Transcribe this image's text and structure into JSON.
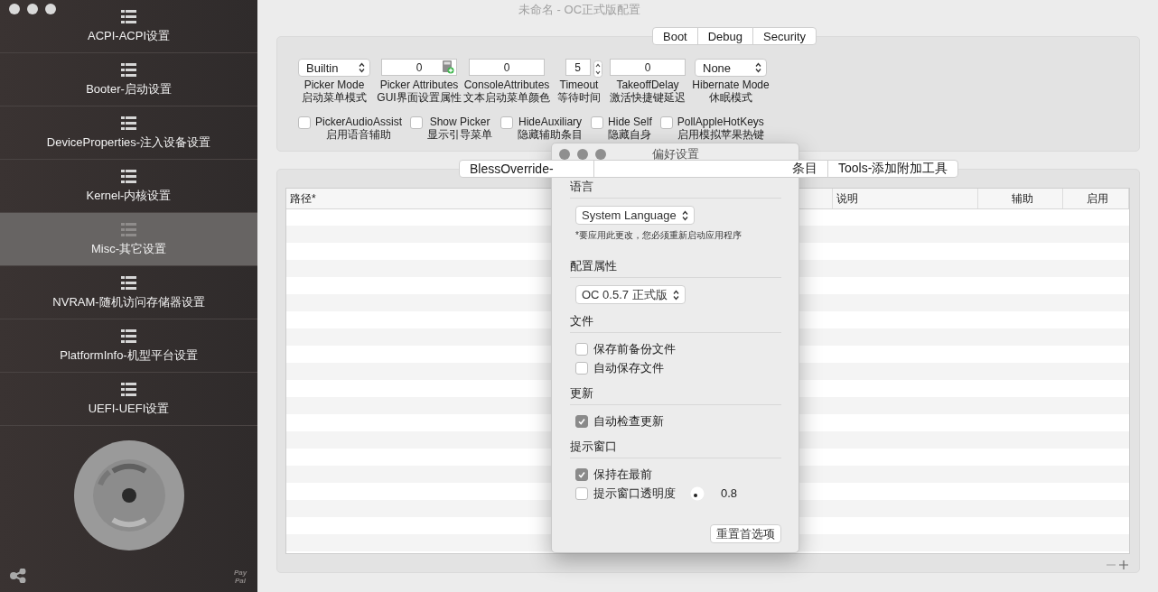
{
  "window": {
    "title": "未命名 - OC正式版配置"
  },
  "sidebar": {
    "items": [
      {
        "label": "ACPI-ACPI设置",
        "selected": false
      },
      {
        "label": "Booter-启动设置",
        "selected": false
      },
      {
        "label": "DeviceProperties-注入设备设置",
        "selected": false
      },
      {
        "label": "Kernel-内核设置",
        "selected": false
      },
      {
        "label": "Misc-其它设置",
        "selected": true
      },
      {
        "label": "NVRAM-随机访问存储器设置",
        "selected": false
      },
      {
        "label": "PlatformInfo-机型平台设置",
        "selected": false
      },
      {
        "label": "UEFI-UEFI设置",
        "selected": false
      }
    ],
    "paypal": "Pay Pal"
  },
  "top_tabs": [
    {
      "label": "Boot",
      "selected": false
    },
    {
      "label": "Debug",
      "selected": false
    },
    {
      "label": "Security",
      "selected": false
    }
  ],
  "boot_fields": [
    {
      "kind": "popup",
      "value": "Builtin",
      "label": "Picker Mode",
      "sublabel": "启动菜单模式"
    },
    {
      "kind": "calc",
      "value": "0",
      "label": "Picker Attributes",
      "sublabel": "GUI界面设置属性"
    },
    {
      "kind": "text",
      "value": "0",
      "label": "ConsoleAttributes",
      "sublabel": "文本启动菜单颜色"
    },
    {
      "kind": "stepper",
      "value": "5",
      "label": "Timeout",
      "sublabel": "等待时间"
    },
    {
      "kind": "text",
      "value": "0",
      "label": "TakeoffDelay",
      "sublabel": "激活快捷键延迟"
    },
    {
      "kind": "popup",
      "value": "None",
      "label": "Hibernate Mode",
      "sublabel": "休眠模式"
    }
  ],
  "boot_checks": [
    {
      "label": "PickerAudioAssist",
      "sublabel": "启用语音辅助",
      "checked": false
    },
    {
      "label": "Show Picker",
      "sublabel": "显示引导菜单",
      "checked": false
    },
    {
      "label": "HideAuxiliary",
      "sublabel": "隐藏辅助条目",
      "checked": false
    },
    {
      "label": "Hide Self",
      "sublabel": "隐藏自身",
      "checked": false
    },
    {
      "label": "PollAppleHotKeys",
      "sublabel": "启用模拟苹果热键",
      "checked": false
    }
  ],
  "sub_tabs": [
    {
      "label": "BlessOverride-",
      "selected": false
    },
    {
      "label": "条目",
      "selected": false
    },
    {
      "label": "Tools-添加附加工具",
      "selected": false
    }
  ],
  "table": {
    "columns": [
      "路径*",
      "说明",
      "辅助",
      "启用"
    ]
  },
  "dialog": {
    "title": "偏好设置",
    "sections": [
      {
        "heading": "语言",
        "items": [
          {
            "kind": "popup",
            "value": "System Language"
          },
          {
            "kind": "note",
            "text": "*要应用此更改，您必须重新启动应用程序"
          }
        ]
      },
      {
        "heading": "配置属性",
        "items": [
          {
            "kind": "popup",
            "value": "OC 0.5.7 正式版"
          }
        ]
      },
      {
        "heading": "文件",
        "items": [
          {
            "kind": "checkbox",
            "label": "保存前备份文件",
            "checked": false
          },
          {
            "kind": "checkbox",
            "label": "自动保存文件",
            "checked": false
          }
        ]
      },
      {
        "heading": "更新",
        "items": [
          {
            "kind": "checkbox",
            "label": "自动检查更新",
            "checked": true
          }
        ]
      },
      {
        "heading": "提示窗口",
        "items": [
          {
            "kind": "checkbox",
            "label": "保持在最前",
            "checked": true
          },
          {
            "kind": "knob",
            "label": "提示窗口透明度",
            "checked": false,
            "reading": "0.8"
          }
        ]
      }
    ],
    "reset_button": "重置首选项"
  }
}
